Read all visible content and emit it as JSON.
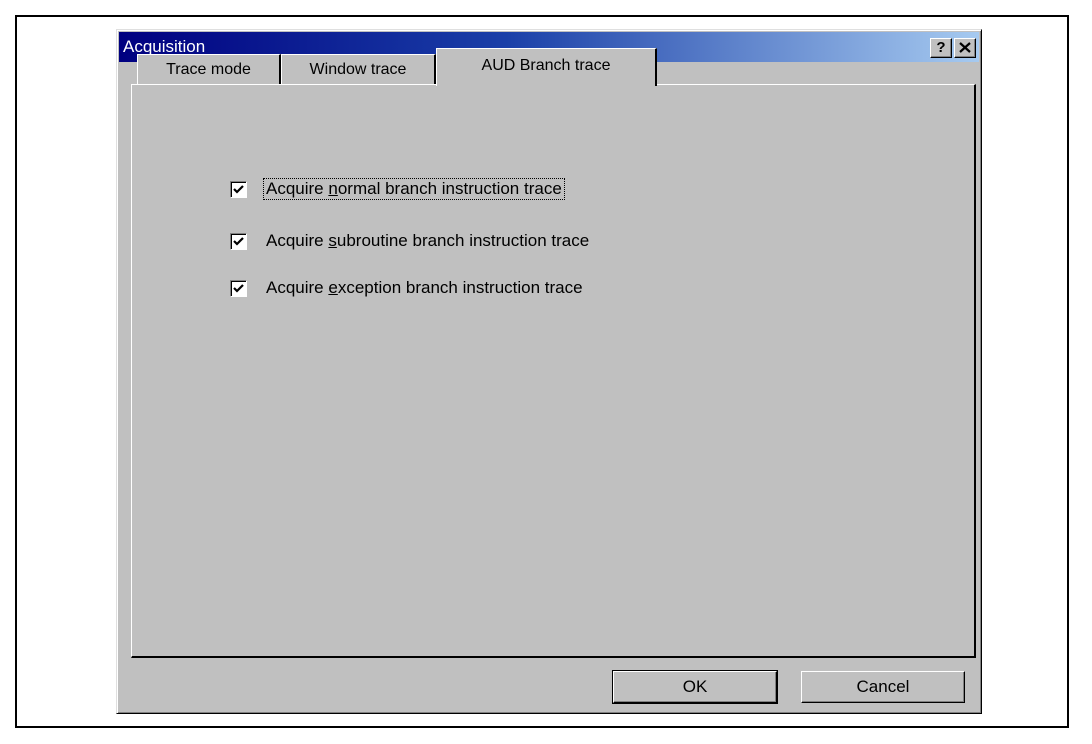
{
  "window": {
    "title": "Acquisition",
    "help_glyph": "?",
    "close_glyph": "✕"
  },
  "tabs": [
    {
      "label": "Trace mode",
      "active": false
    },
    {
      "label": "Window trace",
      "active": false
    },
    {
      "label": "AUD Branch trace",
      "active": true
    }
  ],
  "options": [
    {
      "prefix": "Acquire ",
      "mnemonic": "n",
      "suffix": "ormal branch instruction trace",
      "checked": true,
      "focused": true
    },
    {
      "prefix": "Acquire ",
      "mnemonic": "s",
      "suffix": "ubroutine branch instruction trace",
      "checked": true,
      "focused": false
    },
    {
      "prefix": "Acquire ",
      "mnemonic": "e",
      "suffix": "xception branch instruction trace",
      "checked": true,
      "focused": false
    }
  ],
  "buttons": {
    "ok": "OK",
    "cancel": "Cancel"
  },
  "colors": {
    "titlebar_start": "#000080",
    "titlebar_end": "#a6caf0",
    "face": "#c0c0c0"
  }
}
